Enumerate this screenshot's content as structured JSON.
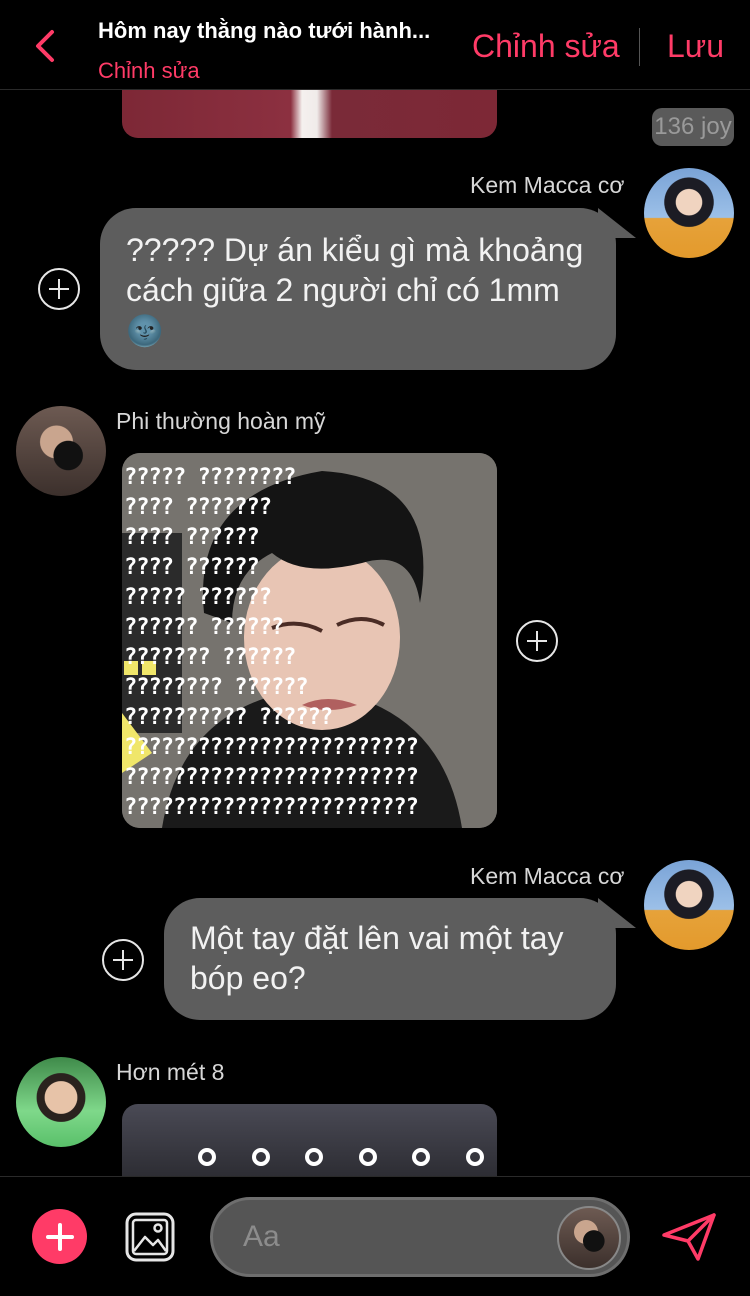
{
  "header": {
    "title": "Hôm nay thằng nào tưới hành...",
    "subtitle": "Chỉnh sửa",
    "edit_label": "Chỉnh sửa",
    "save_label": "Lưu"
  },
  "badge": "136 joy",
  "messages": [
    {
      "sender": "Kem Macca cơ",
      "text": "????? Dự án kiểu gì mà khoảng cách giữa 2 người chỉ có 1mm",
      "emoji": "🌚"
    },
    {
      "sender": "Phi thường hoàn mỹ",
      "type": "image",
      "meme_lines": [
        "?????            ????????",
        "????              ???????",
        "????               ??????",
        "????               ??????",
        "?????              ??????",
        "??????             ??????",
        "???????            ??????",
        "????????           ??????",
        "??????????         ??????",
        "????????????????????????",
        "????????????????????????",
        "????????????????????????"
      ]
    },
    {
      "sender": "Kem Macca cơ",
      "text": "Một tay đặt lên vai một tay bóp eo?"
    },
    {
      "sender": "Hơn mét 8",
      "type": "image"
    }
  ],
  "composer": {
    "placeholder": "Aa"
  },
  "colors": {
    "accent": "#ff3b67",
    "bubble": "#5d5d5d",
    "background": "#000000"
  },
  "icons": {
    "back": "chevron-left-icon",
    "add": "plus-circle-icon",
    "gallery": "image-icon",
    "send": "paper-plane-icon",
    "reaction": "add-reaction-icon"
  }
}
